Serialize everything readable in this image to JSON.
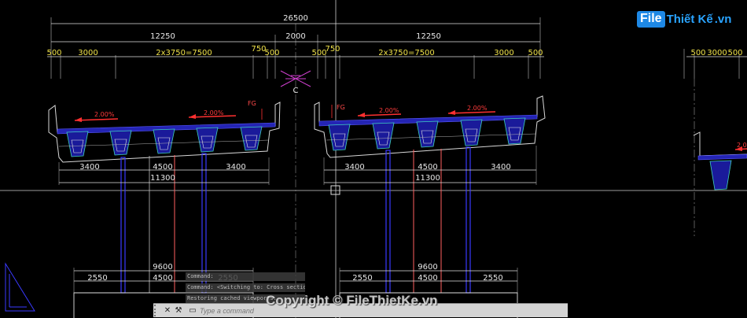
{
  "drawing": {
    "overall_width": "26500",
    "half_width_left": "12250",
    "median_width": "2000",
    "half_width_right": "12250",
    "sub_dims_left": [
      "500",
      "3000",
      "2x3750=7500",
      "750",
      "500"
    ],
    "sub_dims_right": [
      "500",
      "750",
      "2x3750=7500",
      "3000",
      "500"
    ],
    "sub_dims_far": [
      "500",
      "3000",
      "500"
    ],
    "centerline_label": "C",
    "slope_label": "2.00%",
    "fg_label": "FG",
    "pier_dims_left": [
      "3400",
      "4500",
      "3400"
    ],
    "pier_dims_right": [
      "3400",
      "4500",
      "3400"
    ],
    "pier_total_left": "11300",
    "pier_total_right": "11300",
    "footing_total_left": "9600",
    "footing_total_right": "9600",
    "footing_dims_left": [
      "2550",
      "4500",
      "2550"
    ],
    "footing_dims_right": [
      "2550",
      "4500",
      "2550"
    ]
  },
  "command_history": [
    "Command:",
    "Command:   <Switching to: Cross section>",
    "Restoring cached viewports."
  ],
  "command_line": {
    "placeholder": "Type a command",
    "close_icon": "close-icon",
    "customize_icon": "wrench-icon",
    "recent_icon": "command-prompt-icon"
  },
  "watermark": "Copyright © FileThietKe.vn",
  "logo": {
    "part1": "File",
    "part2": "Thiết Kế",
    "part3": ".vn"
  },
  "colors": {
    "background": "#000000",
    "dimension": "#e8e8e8",
    "dimension_yellow": "#f0e24a",
    "girder": "#1a1a9a",
    "pier_blue": "#3a3aff",
    "pier_red": "#ff6060",
    "slope_red": "#ff3030",
    "centerline_magenta": "#d040d0",
    "girder_cyan": "#3fd0c0"
  }
}
